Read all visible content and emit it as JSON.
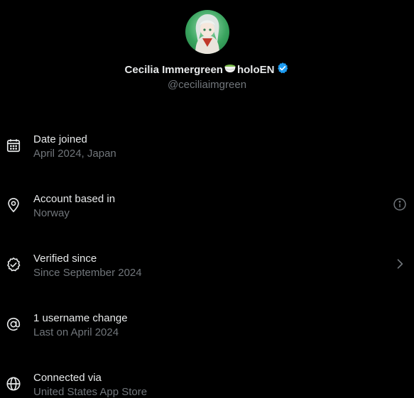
{
  "profile": {
    "display_name_part1": "Cecilia Immergreen",
    "display_name_part2": "holoEN",
    "handle": "@ceciliaimgreen"
  },
  "rows": [
    {
      "title": "Date joined",
      "subtitle": "April 2024, Japan",
      "icon": "calendar-icon",
      "trailing": ""
    },
    {
      "title": "Account based in",
      "subtitle": "Norway",
      "icon": "location-pin-icon",
      "trailing": "info-icon"
    },
    {
      "title": "Verified since",
      "subtitle": "Since September 2024",
      "icon": "verified-badge-icon",
      "trailing": "chevron-right-icon"
    },
    {
      "title": "1 username change",
      "subtitle": "Last on April 2024",
      "icon": "at-sign-icon",
      "trailing": ""
    },
    {
      "title": "Connected via",
      "subtitle": "United States App Store",
      "icon": "globe-icon",
      "trailing": ""
    }
  ],
  "colors": {
    "background": "#000000",
    "primary_text": "#e7e9ea",
    "secondary_text": "#71767b",
    "verified_blue": "#1d9bf0"
  }
}
